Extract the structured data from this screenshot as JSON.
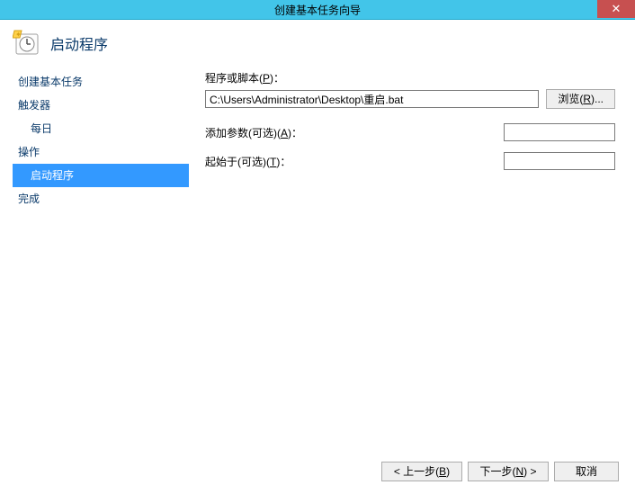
{
  "window": {
    "title": "创建基本任务向导"
  },
  "header": {
    "title": "启动程序"
  },
  "sidebar": {
    "items": [
      {
        "label": "创建基本任务",
        "sub": false,
        "selected": false
      },
      {
        "label": "触发器",
        "sub": false,
        "selected": false
      },
      {
        "label": "每日",
        "sub": true,
        "selected": false
      },
      {
        "label": "操作",
        "sub": false,
        "selected": false
      },
      {
        "label": "启动程序",
        "sub": true,
        "selected": true
      },
      {
        "label": "完成",
        "sub": false,
        "selected": false
      }
    ]
  },
  "form": {
    "scriptLabelPrefix": "程序或脚本(",
    "scriptLabelKey": "P",
    "scriptLabelSuffix": ")：",
    "scriptPath": "C:\\Users\\Administrator\\Desktop\\重启.bat",
    "browsePrefix": "浏览(",
    "browseKey": "R",
    "browseSuffix": ")...",
    "argsLabelPrefix": "添加参数(可选)(",
    "argsLabelKey": "A",
    "argsLabelSuffix": ")：",
    "argsValue": "",
    "startInLabelPrefix": "起始于(可选)(",
    "startInLabelKey": "T",
    "startInLabelSuffix": ")：",
    "startInValue": ""
  },
  "footer": {
    "backPrefix": "< 上一步(",
    "backKey": "B",
    "backSuffix": ")",
    "nextPrefix": "下一步(",
    "nextKey": "N",
    "nextSuffix": ") >",
    "cancel": "取消"
  }
}
